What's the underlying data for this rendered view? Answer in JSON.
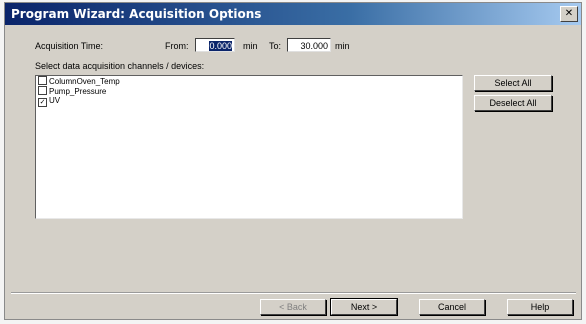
{
  "window": {
    "title": "Program Wizard: Acquisition Options",
    "close_glyph": "✕"
  },
  "acquisition": {
    "label": "Acquisition Time:",
    "from_label": "From:",
    "from_value": "0.000",
    "from_unit": "min",
    "to_label": "To:",
    "to_value": "30.000",
    "to_unit": "min"
  },
  "channels": {
    "label": "Select data acquisition channels / devices:",
    "items": [
      {
        "label": "ColumnOven_Temp",
        "checked": false
      },
      {
        "label": "Pump_Pressure",
        "checked": false
      },
      {
        "label": "UV",
        "checked": true
      }
    ],
    "check_glyph": "✓",
    "select_all_label": "Select All",
    "deselect_all_label": "Deselect All"
  },
  "footer": {
    "back_label": "< Back",
    "next_label": "Next >",
    "cancel_label": "Cancel",
    "help_label": "Help"
  }
}
